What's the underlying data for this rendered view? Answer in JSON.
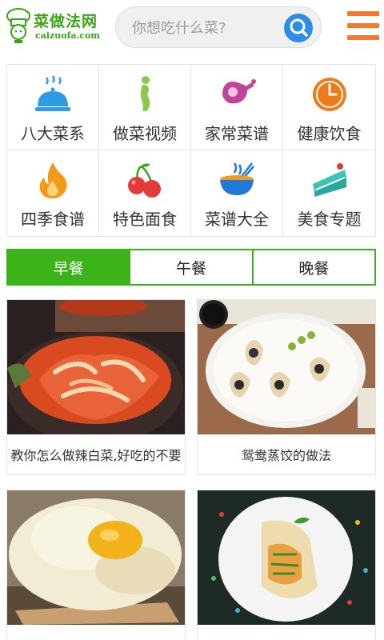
{
  "header": {
    "logo_title": "菜做法网",
    "logo_sub": "caizuofa.com",
    "search_placeholder": "你想吃什么菜?",
    "search_icon": "search-icon",
    "menu_icon": "hamburger-menu-icon"
  },
  "categories": [
    {
      "label": "八大菜系",
      "icon": "cloche-icon",
      "color": "#2f9be3"
    },
    {
      "label": "做菜视频",
      "icon": "figure-icon",
      "color": "#8cc84b"
    },
    {
      "label": "家常菜谱",
      "icon": "ham-leg-icon",
      "color": "#c0449a"
    },
    {
      "label": "健康饮食",
      "icon": "clock-icon",
      "color": "#f07a1a"
    },
    {
      "label": "四季食谱",
      "icon": "flame-icon",
      "color": "#f39a1a"
    },
    {
      "label": "特色面食",
      "icon": "cherries-icon",
      "color": "#e33a3a"
    },
    {
      "label": "菜谱大全",
      "icon": "bowl-icon",
      "color": "#1e7ad8"
    },
    {
      "label": "美食专题",
      "icon": "cake-slice-icon",
      "color": "#3cc2b8"
    }
  ],
  "tabs": [
    {
      "label": "早餐",
      "active": true
    },
    {
      "label": "午餐",
      "active": false
    },
    {
      "label": "晚餐",
      "active": false
    }
  ],
  "recipes": [
    {
      "title": "教你怎么做辣白菜,好吃的不要",
      "image": "kimchi-photo"
    },
    {
      "title": "鸳鸯蒸饺的做法",
      "image": "dumplings-photo"
    },
    {
      "title": "",
      "image": "cloud-egg-photo"
    },
    {
      "title": "",
      "image": "wrap-roll-photo"
    }
  ],
  "colors": {
    "brand_green": "#3db31a",
    "accent_orange": "#f07a30",
    "search_blue": "#2a8de6"
  }
}
